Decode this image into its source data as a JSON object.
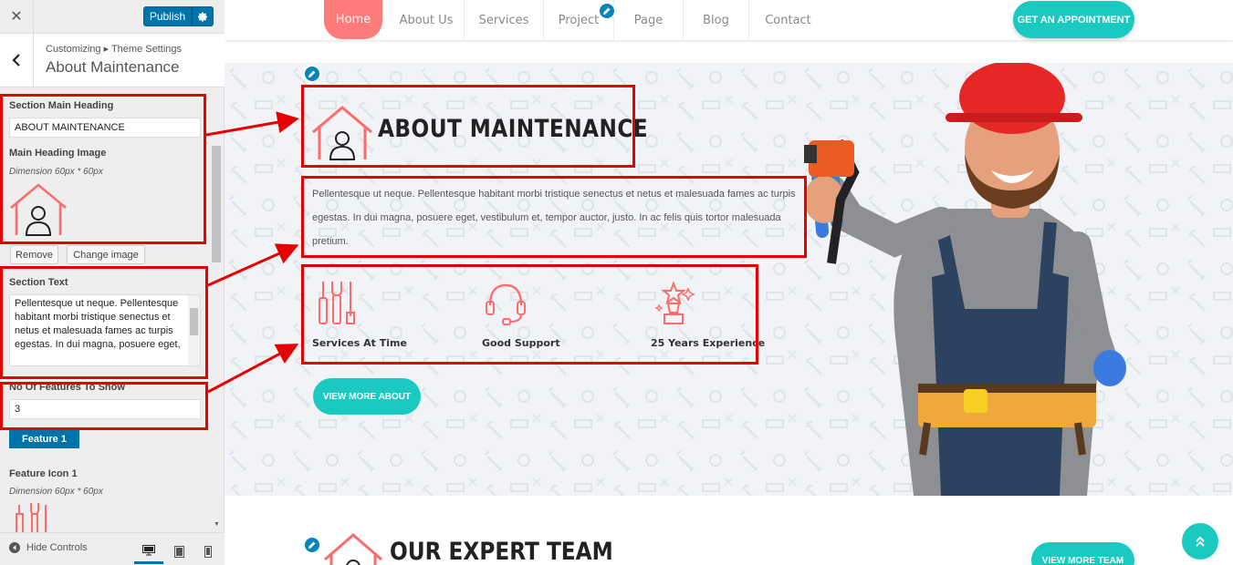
{
  "customizer": {
    "close_icon": "close-icon",
    "publish_label": "Publish",
    "breadcrumb": "Customizing ▸ Theme Settings",
    "section_title": "About Maintenance",
    "fields": {
      "section_main_heading_label": "Section Main Heading",
      "section_main_heading_value": "ABOUT MAINTENANCE",
      "main_heading_image_label": "Main Heading Image",
      "main_heading_image_dimension": "Dimension 60px * 60px",
      "remove_label": "Remove",
      "change_image_label": "Change image",
      "section_text_label": "Section Text",
      "section_text_value": "Pellentesque ut neque. Pellentesque habitant morbi tristique senectus et netus et malesuada fames ac turpis egestas. In dui magna, posuere eget,",
      "no_of_features_label": "No Of Features To Show",
      "no_of_features_value": "3",
      "feature_1_label": "Feature 1",
      "feature_icon_1_label": "Feature Icon 1",
      "feature_icon_1_dimension": "Dimension 60px * 60px"
    },
    "footer": {
      "hide_controls_label": "Hide Controls",
      "devices": [
        "desktop",
        "tablet",
        "mobile"
      ],
      "active_device": "desktop"
    }
  },
  "preview": {
    "nav": {
      "items": [
        "Home",
        "About Us",
        "Services",
        "Project",
        "Page",
        "Blog",
        "Contact"
      ],
      "active": "Home",
      "cta_label": "GET AN APPOINTMENT"
    },
    "about": {
      "heading": "ABOUT MAINTENANCE",
      "text": "Pellentesque ut neque. Pellentesque habitant morbi tristique senectus et netus et malesuada fames ac turpis egestas. In dui magna, posuere eget, vestibulum et, tempor auctor, justo. In ac felis quis tortor malesuada pretium.",
      "features": [
        {
          "label": "Services At Time",
          "icon": "tools-icon"
        },
        {
          "label": "Good Support",
          "icon": "headset-icon"
        },
        {
          "label": "25 Years Experience",
          "icon": "trophy-icon"
        }
      ],
      "button_label": "VIEW MORE ABOUT"
    },
    "team": {
      "heading": "OUR EXPERT TEAM",
      "button_label": "VIEW MORE TEAM"
    }
  },
  "colors": {
    "accent_teal": "#1ac9c0",
    "accent_coral": "#ff7b7b",
    "wp_blue": "#0073aa",
    "annotation_red": "#e60000"
  }
}
